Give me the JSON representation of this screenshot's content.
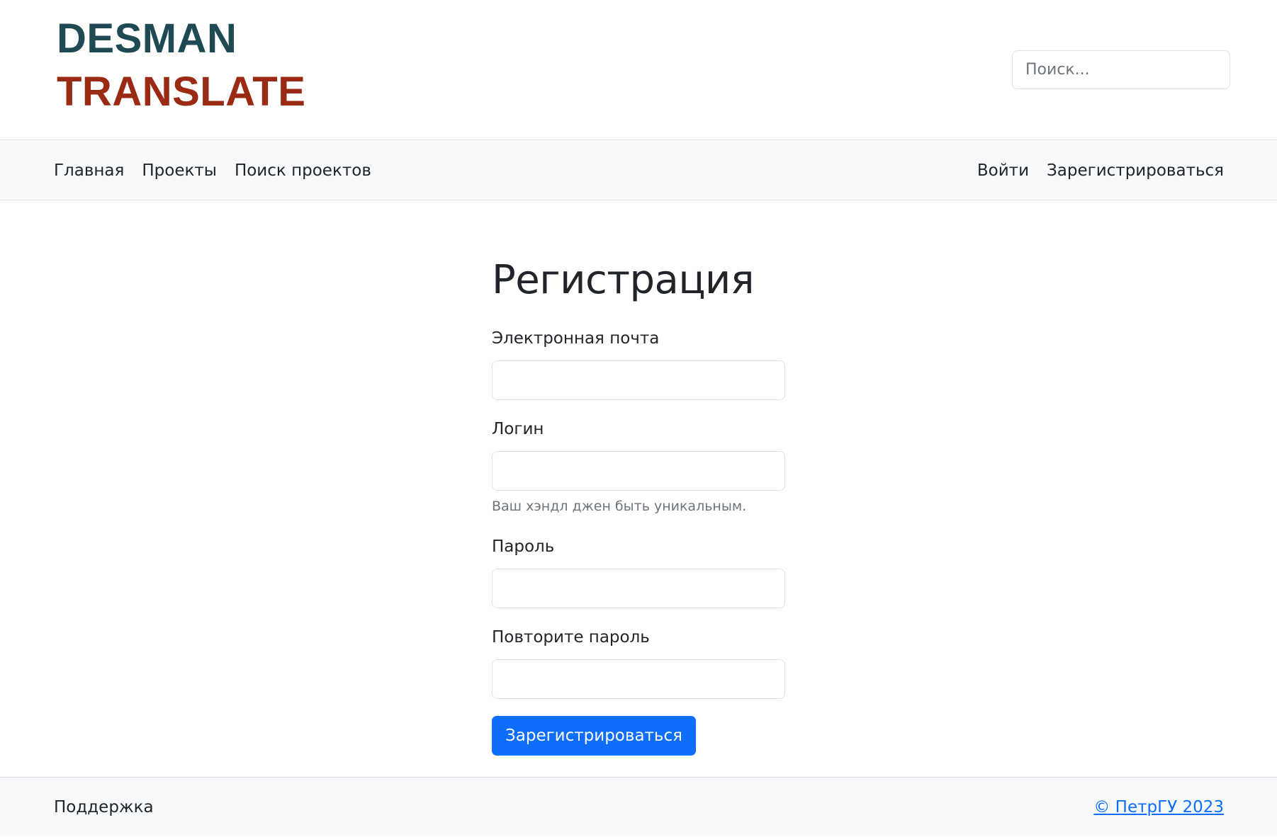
{
  "header": {
    "logo_line1": "DESMAN",
    "logo_line2": "TRANSLATE",
    "logo_colors": {
      "line1": "#1f4a54",
      "line2": "#9b2a14"
    },
    "search_placeholder": "Поиск..."
  },
  "nav": {
    "left_items": [
      {
        "label": "Главная"
      },
      {
        "label": "Проекты"
      },
      {
        "label": "Поиск проектов"
      }
    ],
    "right_items": [
      {
        "label": "Войти"
      },
      {
        "label": "Зарегистрироваться"
      }
    ]
  },
  "form": {
    "title": "Регистрация",
    "email_label": "Электронная почта",
    "email_value": "",
    "login_label": "Логин",
    "login_value": "",
    "login_help": "Ваш хэндл джен быть уникальным.",
    "password_label": "Пароль",
    "password_value": "",
    "password_repeat_label": "Повторите пароль",
    "password_repeat_value": "",
    "submit_label": "Зарегистрироваться"
  },
  "footer": {
    "support_label": "Поддержка",
    "copyright": "© ПетрГУ 2023"
  },
  "colors": {
    "accent": "#0d6efd",
    "nav_background": "#f8f9fa",
    "border": "#dee2e6"
  }
}
